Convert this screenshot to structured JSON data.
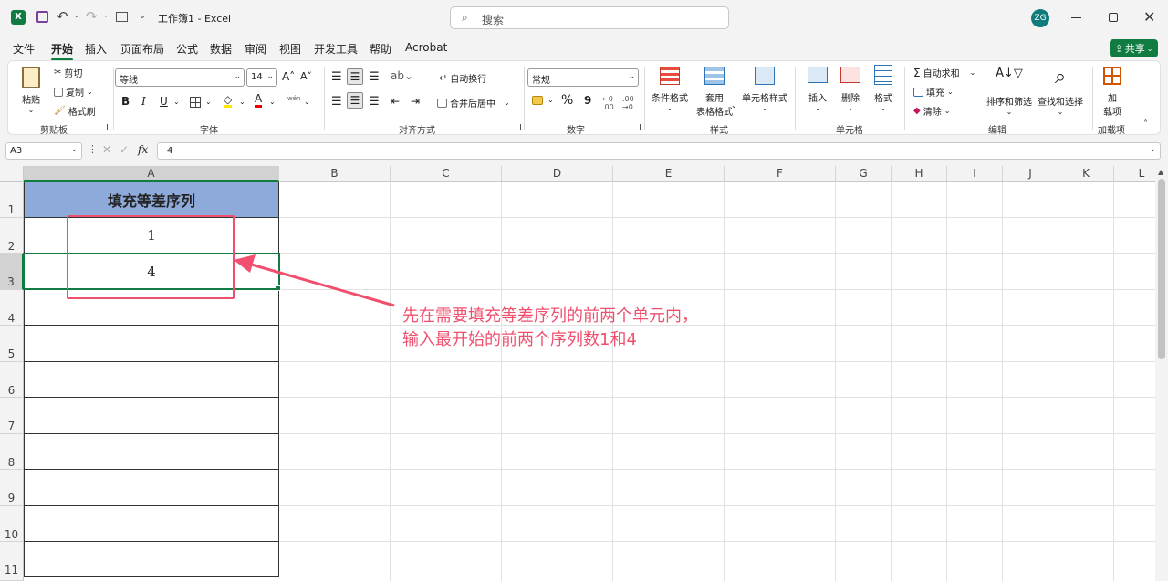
{
  "titlebar": {
    "qat_dropdown": "⌄",
    "document_title": "工作簿1 - Excel",
    "search_placeholder": "搜索",
    "user_initials": "ZG"
  },
  "menu": {
    "tabs": [
      "文件",
      "开始",
      "插入",
      "页面布局",
      "公式",
      "数据",
      "审阅",
      "视图",
      "开发工具",
      "帮助",
      "Acrobat"
    ],
    "share_label": "共享"
  },
  "ribbon": {
    "clipboard": {
      "paste": "粘贴",
      "cut": "剪切",
      "copy": "复制",
      "format_painter": "格式刷",
      "label": "剪贴板"
    },
    "font": {
      "name": "等线",
      "size": "14",
      "grow": "A˄",
      "shrink": "A˅",
      "bold": "B",
      "italic": "I",
      "underline": "U",
      "phonetic": "wén",
      "label": "字体"
    },
    "alignment": {
      "wrap": "自动换行",
      "merge": "合并后居中",
      "label": "对齐方式"
    },
    "number": {
      "format": "常规",
      "percent": "%",
      "comma": "9",
      "label": "数字"
    },
    "styles": {
      "conditional": "条件格式",
      "table_line1": "套用",
      "table_line2": "表格格式",
      "cell_styles": "单元格样式",
      "label": "样式"
    },
    "cells": {
      "insert": "插入",
      "delete": "删除",
      "format": "格式",
      "label": "单元格"
    },
    "editing": {
      "autosum": "自动求和",
      "fill": "填充",
      "clear": "清除",
      "sort_filter": "排序和筛选",
      "find_select": "查找和选择",
      "label": "编辑"
    },
    "addins": {
      "line1": "加",
      "line2": "载项",
      "label": "加载项"
    }
  },
  "formula_bar": {
    "name_box": "A3",
    "fx": "fx",
    "value": "4"
  },
  "sheet": {
    "columns": [
      "A",
      "B",
      "C",
      "D",
      "E",
      "F",
      "G",
      "H",
      "I",
      "J",
      "K",
      "L"
    ],
    "rows": [
      "1",
      "2",
      "3",
      "4",
      "5",
      "6",
      "7",
      "8",
      "9",
      "10",
      "11"
    ],
    "header_cell": "填充等差序列",
    "cell_a2": "1",
    "cell_a3": "4",
    "header_fill": "#8eaadb"
  },
  "annotation": {
    "line1": "先在需要填充等差序列的前两个单元内，",
    "line2": "输入最开始的前两个序列数1和4",
    "color": "#f0506e"
  }
}
